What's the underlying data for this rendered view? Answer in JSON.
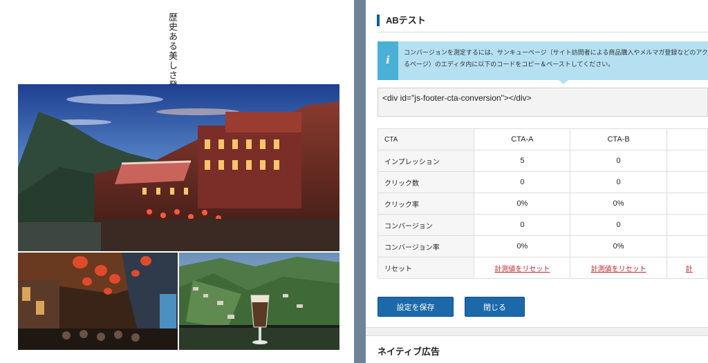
{
  "preview": {
    "vertical_title": "歴史ある美しさ発見"
  },
  "ab_test": {
    "title": "ABテスト",
    "info_icon": "info-icon",
    "info_line1": "コンバージョンを測定するには、サンキューページ（サイト訪問者による商品購入やメルマガ登録などのアク",
    "info_line2": "るページ）のエディタ内に以下のコードをコピー＆ペーストしてください。",
    "code": "<div id=\"js-footer-cta-conversion\"></div>",
    "table": {
      "header": [
        "CTA",
        "CTA-A",
        "CTA-B"
      ],
      "rows": [
        {
          "label": "インプレッション",
          "a": "5",
          "b": "0"
        },
        {
          "label": "クリック数",
          "a": "0",
          "b": "0"
        },
        {
          "label": "クリック率",
          "a": "0%",
          "b": "0%"
        },
        {
          "label": "コンバージョン",
          "a": "0",
          "b": "0"
        },
        {
          "label": "コンバージョン率",
          "a": "0%",
          "b": "0%"
        }
      ],
      "reset_label": "リセット",
      "reset_a": "計測値をリセット",
      "reset_b": "計測値をリセット",
      "reset_c_partial": "計"
    },
    "save_button": "設定を保存",
    "close_button": "閉じる"
  },
  "native_ad": {
    "title": "ネイティブ広告"
  },
  "colors": {
    "accent": "#0a5d9a",
    "button": "#1c69a9",
    "info_bg": "#b4e0f1",
    "info_icon_bg": "#4ab0d6",
    "reset_link": "#c0282c",
    "divider": "#6f8396"
  }
}
